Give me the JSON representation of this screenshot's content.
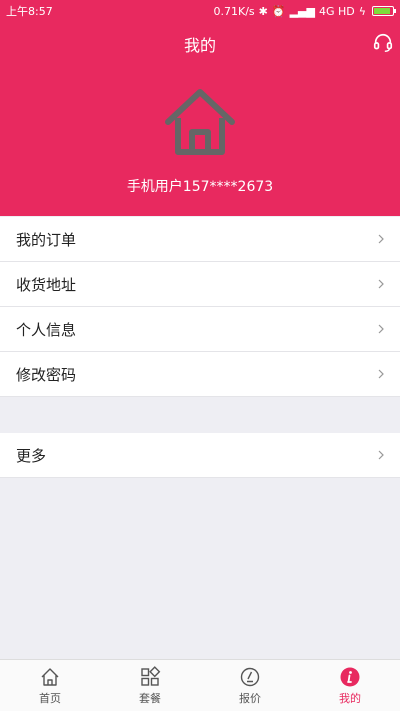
{
  "status_bar": {
    "time": "上午8:57",
    "speed": "0.71K/s",
    "network": "4G HD"
  },
  "header": {
    "title": "我的",
    "user_name": "手机用户157****2673"
  },
  "menu_primary": [
    {
      "label": "我的订单"
    },
    {
      "label": "收货地址"
    },
    {
      "label": "个人信息"
    },
    {
      "label": "修改密码"
    }
  ],
  "menu_secondary": [
    {
      "label": "更多"
    }
  ],
  "tabbar": {
    "tabs": [
      {
        "label": "首页",
        "icon": "home-icon",
        "active": false
      },
      {
        "label": "套餐",
        "icon": "grid-icon",
        "active": false
      },
      {
        "label": "报价",
        "icon": "quote-icon",
        "active": false
      },
      {
        "label": "我的",
        "icon": "info-icon",
        "active": true
      }
    ]
  },
  "colors": {
    "brand": "#e8295f",
    "active_tab": "#e8295f"
  }
}
